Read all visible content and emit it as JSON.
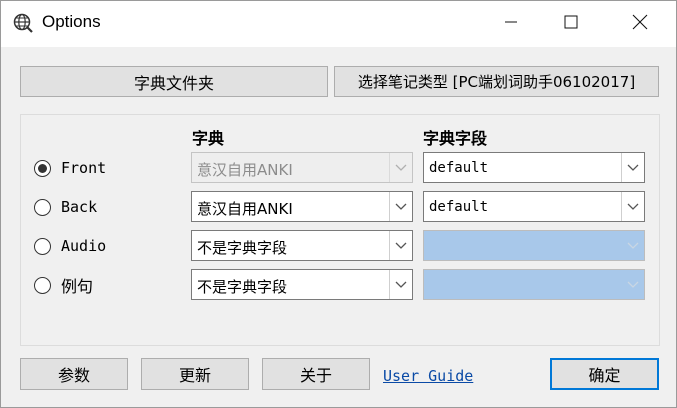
{
  "window": {
    "title": "Options",
    "icon": "globe-search-icon"
  },
  "titlebar_buttons": {
    "minimize_icon": "minimize-icon",
    "maximize_icon": "maximize-icon",
    "close_icon": "close-icon"
  },
  "top_buttons": {
    "folder_label": "字典文件夹",
    "notetype_label": "选择笔记类型 [PC端划词助手06102017]"
  },
  "columns": {
    "dictionary": "字典",
    "field": "字典字段"
  },
  "rows": [
    {
      "label": "Front",
      "selected": true,
      "dict_value": "意汉自用ANKI",
      "dict_disabled": true,
      "field_value": "default"
    },
    {
      "label": "Back",
      "selected": false,
      "dict_value": "意汉自用ANKI",
      "dict_disabled": false,
      "field_value": "default"
    },
    {
      "label": "Audio",
      "selected": false,
      "dict_value": "不是字典字段",
      "dict_disabled": false,
      "field_value": ""
    },
    {
      "label": "例句",
      "selected": false,
      "dict_value": "不是字典字段",
      "dict_disabled": false,
      "field_value": ""
    }
  ],
  "bottom_buttons": {
    "params_label": "参数",
    "update_label": "更新",
    "about_label": "关于",
    "guide_link": "User Guide",
    "ok_label": "确定"
  },
  "colors": {
    "accent": "#0078d7",
    "link": "#0a4aa6",
    "empty_field": "#a8c8ea"
  }
}
